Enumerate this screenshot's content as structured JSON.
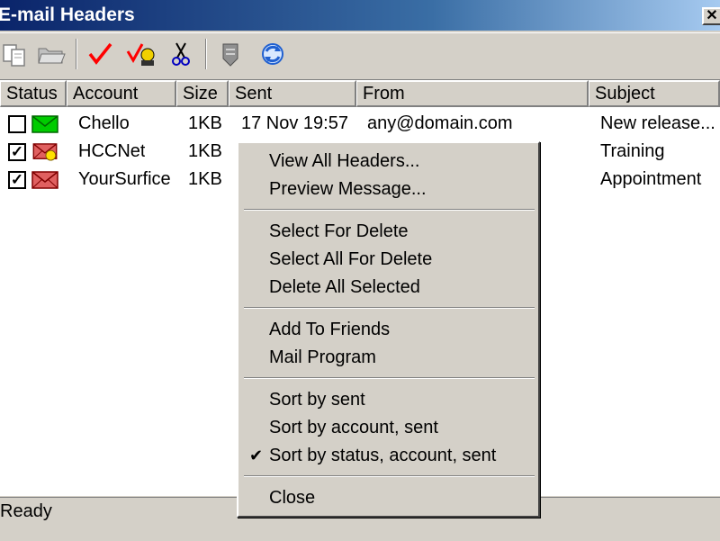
{
  "window": {
    "title": "E-mail Headers",
    "close_glyph": "✕"
  },
  "toolbar": {
    "buttons": [
      {
        "icon": "copy-icon"
      },
      {
        "icon": "open-folder-icon"
      },
      {
        "icon": "check-icon"
      },
      {
        "icon": "check-friend-icon"
      },
      {
        "icon": "scissors-icon"
      },
      {
        "icon": "mail-program-icon"
      },
      {
        "icon": "refresh-icon"
      }
    ]
  },
  "columns": [
    "Status",
    "Account",
    "Size",
    "Sent",
    "From",
    "Subject"
  ],
  "rows": [
    {
      "checked": false,
      "check_mark": "",
      "envelope": "green",
      "account": "Chello",
      "size": "1KB",
      "sent": "17 Nov 19:57",
      "from": "any@domain.com",
      "subject": "New release..."
    },
    {
      "checked": true,
      "check_mark": "✓",
      "envelope": "red-friend",
      "account": "HCCNet",
      "size": "1KB",
      "sent": "",
      "from": "",
      "subject": "Training"
    },
    {
      "checked": true,
      "check_mark": "✓",
      "envelope": "red",
      "account": "YourSurfice",
      "size": "1KB",
      "sent": "",
      "from": "",
      "subject": "Appointment"
    }
  ],
  "context_menu": {
    "items": {
      "view_all_headers": "View All Headers...",
      "preview_message": "Preview Message...",
      "select_for_delete": "Select For Delete",
      "select_all_for_delete": "Select All For Delete",
      "delete_all_selected": "Delete All Selected",
      "add_to_friends": "Add To Friends",
      "mail_program": "Mail Program",
      "sort_by_sent": "Sort by sent",
      "sort_by_account_sent": "Sort by account, sent",
      "sort_by_status_account_sent": "Sort by status, account, sent",
      "close": "Close"
    },
    "checked_glyph": "✔"
  },
  "status_bar": {
    "text": "Ready"
  },
  "colors": {
    "envelope_green": "#00cc00",
    "envelope_red": "#e06060",
    "check_red": "#ff0000"
  }
}
